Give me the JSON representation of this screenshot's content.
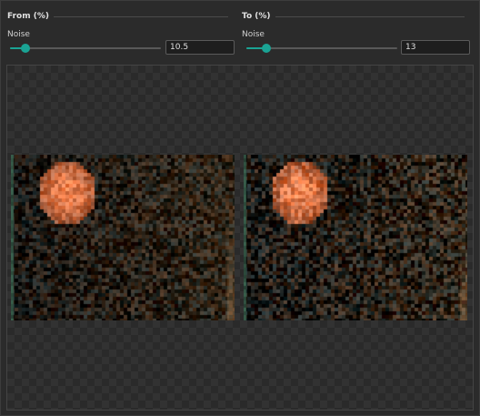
{
  "from": {
    "section_title": "From (%)",
    "param_label": "Noise",
    "value": "10.5",
    "slider_fraction": 0.105
  },
  "to": {
    "section_title": "To (%)",
    "param_label": "Noise",
    "value": "13",
    "slider_fraction": 0.13
  },
  "colors": {
    "accent": "#1aa394",
    "background": "#2b2b2b",
    "orb": "#e98a58"
  },
  "icons": {
    "slider_thumb": "circle-knob"
  }
}
